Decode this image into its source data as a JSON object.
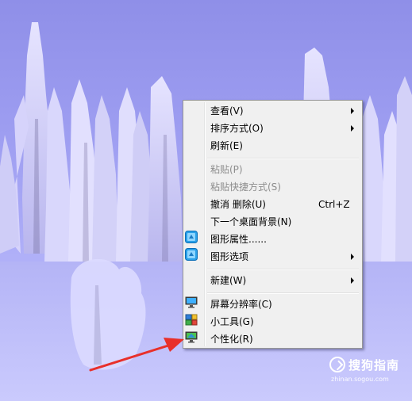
{
  "context_menu": {
    "items": [
      {
        "label": "查看(V)",
        "submenu": true
      },
      {
        "label": "排序方式(O)",
        "submenu": true
      },
      {
        "label": "刷新(E)"
      },
      {
        "label": "粘贴(P)",
        "disabled": true
      },
      {
        "label": "粘贴快捷方式(S)",
        "disabled": true
      },
      {
        "label": "撤消 删除(U)",
        "shortcut": "Ctrl+Z"
      },
      {
        "label": "下一个桌面背景(N)"
      },
      {
        "label": "图形属性......",
        "icon": "intel-graphics-icon"
      },
      {
        "label": "图形选项",
        "icon": "intel-graphics-icon",
        "submenu": true
      },
      {
        "label": "新建(W)",
        "submenu": true
      },
      {
        "label": "屏幕分辨率(C)",
        "icon": "display-monitor-icon"
      },
      {
        "label": "小工具(G)",
        "icon": "gadgets-icon"
      },
      {
        "label": "个性化(R)",
        "icon": "personalize-icon"
      }
    ]
  },
  "annotation": {
    "color": "#e8302a",
    "icon": "arrow-pointer-icon"
  },
  "watermark": {
    "brand": "搜狗指南",
    "url": "zhinan.sogou.com",
    "icon": "sogou-logo-icon"
  },
  "colors": {
    "sky": "#9c9cf0",
    "menu_bg": "#f0f0f0",
    "menu_border": "#979797",
    "disabled_text": "#8d8d8d"
  }
}
